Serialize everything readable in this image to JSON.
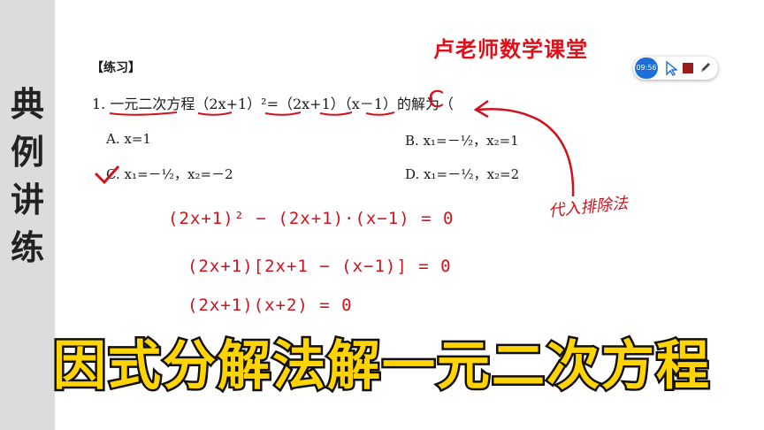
{
  "side_title": [
    "典",
    "例",
    "讲",
    "练"
  ],
  "brand": "卢老师数学课堂",
  "section_label": "【练习】",
  "toolbar": {
    "time": "09:56",
    "pen_label": "N"
  },
  "question": {
    "number": "1.",
    "text": "一元二次方程（2x+1）²=（2x+1）（x－1）的解为（",
    "answer": "C"
  },
  "options": {
    "A": "A.  x=1",
    "B": "B.  x₁=－½，x₂=1",
    "C": "C.  x₁=－½，x₂=－2",
    "D": "D.  x₁=－½，x₂=2"
  },
  "handwriting": {
    "line1": "(2x+1)² − (2x+1)·(x−1) = 0",
    "line2": "(2x+1)[2x+1 − (x−1)] = 0",
    "line3": "(2x+1)(x+2) = 0",
    "note": "代入排除法"
  },
  "banner": "因式分解法解一元二次方程",
  "colors": {
    "annotation": "#d0121c",
    "banner_fill": "#ffd400",
    "toolbar_accent": "#1e6fd9"
  }
}
